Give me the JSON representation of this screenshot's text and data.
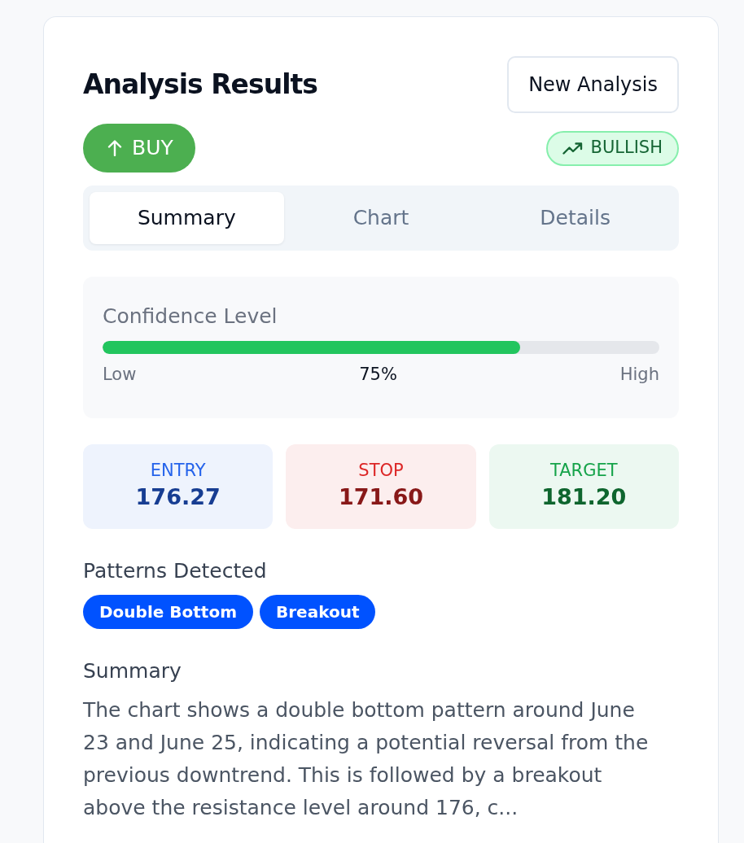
{
  "header": {
    "title": "Analysis Results",
    "new_button": "New Analysis"
  },
  "signal": {
    "label": "BUY"
  },
  "trend": {
    "label": "BULLISH"
  },
  "tabs": [
    {
      "label": "Summary",
      "selected": true
    },
    {
      "label": "Chart",
      "selected": false
    },
    {
      "label": "Details",
      "selected": false
    }
  ],
  "confidence": {
    "title": "Confidence Level",
    "level": 0.75,
    "low_label": "Low",
    "reading": "75%",
    "high_label": "High"
  },
  "levels": [
    {
      "label": "ENTRY",
      "value": "176.27",
      "color": "#2563eb"
    },
    {
      "label": "STOP",
      "value": "171.60",
      "color": "#dc2626"
    },
    {
      "label": "TARGET",
      "value": "181.20",
      "color": "#16a34a"
    }
  ],
  "patterns": {
    "title": "Patterns Detected",
    "items": [
      "Double Bottom",
      "Breakout"
    ]
  },
  "summary": {
    "title": "Summary",
    "text": "The chart shows a double bottom pattern around June 23 and June 25, indicating a potential reversal from the previous downtrend. This is followed by a breakout above the resistance level around 176, c..."
  }
}
